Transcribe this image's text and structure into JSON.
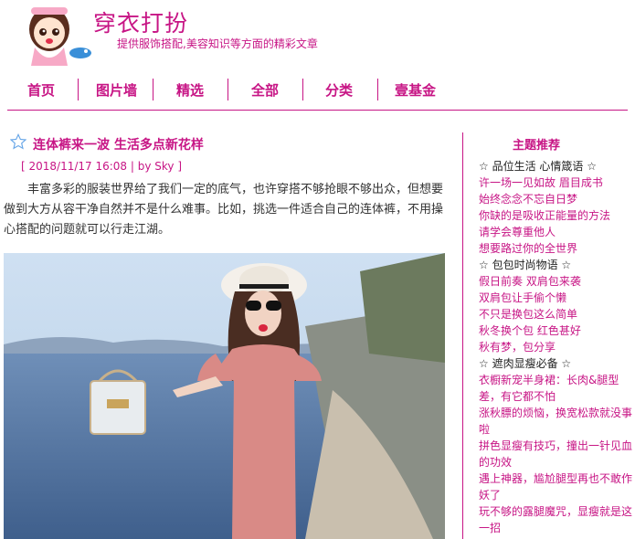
{
  "header": {
    "title": "穿衣打扮",
    "subtitle": "提供服饰搭配,美容知识等方面的精彩文章"
  },
  "nav": [
    "首页",
    "图片墙",
    "精选",
    "全部",
    "分类",
    "壹基金"
  ],
  "article": {
    "title": "连体裤来一波 生活多点新花样",
    "meta_prefix": "[ ",
    "date": "2018/11/17 16:08",
    "by": " | by ",
    "author": "Sky",
    "meta_suffix": " ]",
    "body": "丰富多彩的服装世界给了我们一定的底气，也许穿搭不够抢眼不够出众，但想要做到大方从容干净自然并不是什么难事。比如，挑选一件适合自己的连体裤，不用操心搭配的问题就可以行走江湖。"
  },
  "sidebar": {
    "title": "主题推荐",
    "items": [
      {
        "type": "head",
        "text": "☆ 品位生活 心情箴语 ☆"
      },
      {
        "type": "link",
        "text": "许一场一见如故 眉目成书"
      },
      {
        "type": "link",
        "text": "始终念念不忘自日梦"
      },
      {
        "type": "link",
        "text": "你缺的是吸收正能量的方法"
      },
      {
        "type": "link",
        "text": "请学会尊重他人"
      },
      {
        "type": "link",
        "text": "想要路过你的全世界"
      },
      {
        "type": "head",
        "text": "☆ 包包时尚物语 ☆"
      },
      {
        "type": "link",
        "text": "假日前奏 双肩包来袭"
      },
      {
        "type": "link",
        "text": "双肩包让手偷个懒"
      },
      {
        "type": "link",
        "text": "不只是换包这么简单"
      },
      {
        "type": "link",
        "text": "秋冬换个包 红色甚好"
      },
      {
        "type": "link",
        "text": "秋有梦，包分享"
      },
      {
        "type": "head",
        "text": "☆ 遮肉显瘦必备 ☆"
      },
      {
        "type": "link",
        "text": "衣橱新宠半身裙：长肉&腿型差，有它都不怕"
      },
      {
        "type": "link",
        "text": "涨秋膘的烦恼，换宽松款就没事啦"
      },
      {
        "type": "link",
        "text": "拼色显瘦有技巧，撞出一针见血的功效"
      },
      {
        "type": "link",
        "text": "遇上神器，尴尬腿型再也不敢作妖了"
      },
      {
        "type": "link",
        "text": "玩不够的露腿魔咒，显瘦就是这一招"
      }
    ]
  },
  "colors": {
    "accent": "#c71585",
    "text": "#333333"
  }
}
